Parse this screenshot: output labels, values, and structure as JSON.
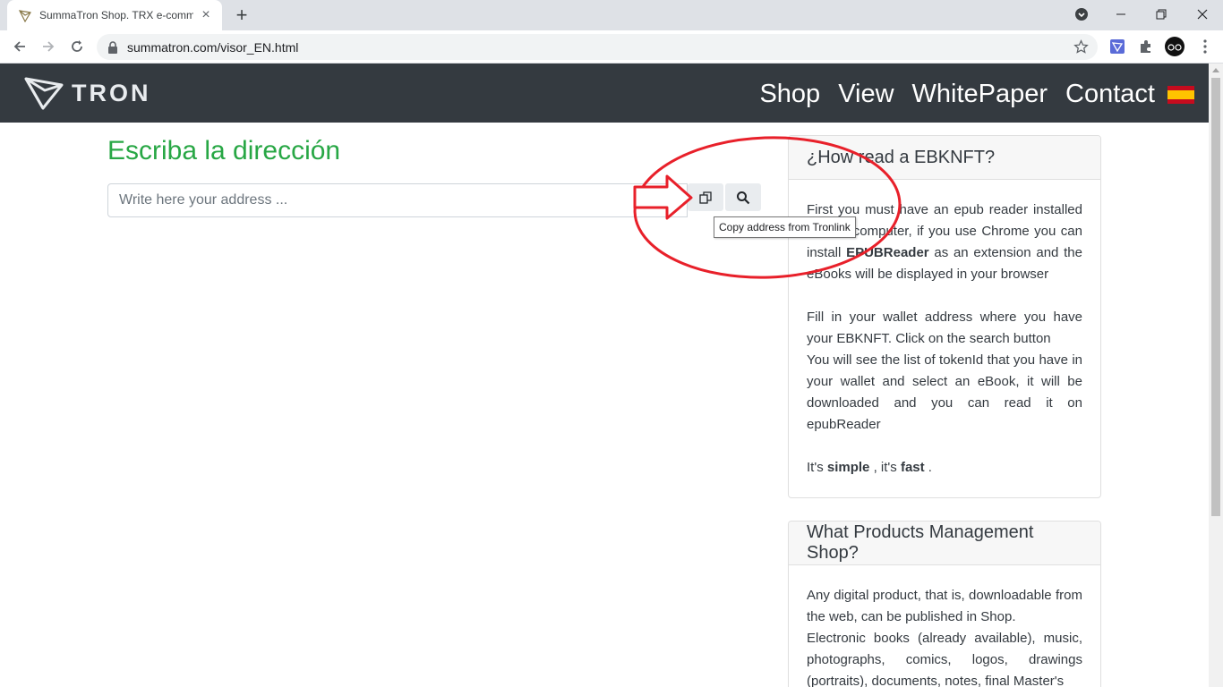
{
  "browser": {
    "tab_title": "SummaTron Shop. TRX e-comme",
    "url": "summatron.com/visor_EN.html"
  },
  "site": {
    "brand": "TRON",
    "menu": [
      "Shop",
      "View",
      "WhitePaper",
      "Contact"
    ],
    "flag_icon": "spain-flag-icon"
  },
  "main": {
    "title": "Escriba la dirección",
    "address_placeholder": "Write here your address ...",
    "tooltip": "Copy address from Tronlink",
    "annotation_color": "#e8202a"
  },
  "cards": {
    "how": {
      "header": "¿How read a EBKNFT?",
      "p1_a": "First you must have an epub reader installed in your computer, if you use Chrome you can install ",
      "p1_strong": "EPUBReader",
      "p1_b": " as an extension and the eBooks will be displayed in your browser",
      "p2": "Fill in your wallet address where you have your EBKNFT. Click on the search button",
      "p3": "You will see the list of tokenId that you have in your wallet and select an eBook, it will be downloaded and you can read it on epubReader",
      "p4_a": "It's ",
      "p4_strong1": "simple",
      "p4_b": " , it's ",
      "p4_strong2": "fast",
      "p4_c": " ."
    },
    "products": {
      "header": "What Products Management Shop?",
      "p1": "Any digital product, that is, downloadable from the web, can be published in Shop.",
      "p2": "Electronic books (already available), music, photographs, comics, logos, drawings (portraits), documents, notes, final Master's"
    }
  },
  "colors": {
    "navbar": "#343a40",
    "title_green": "#28a745"
  }
}
